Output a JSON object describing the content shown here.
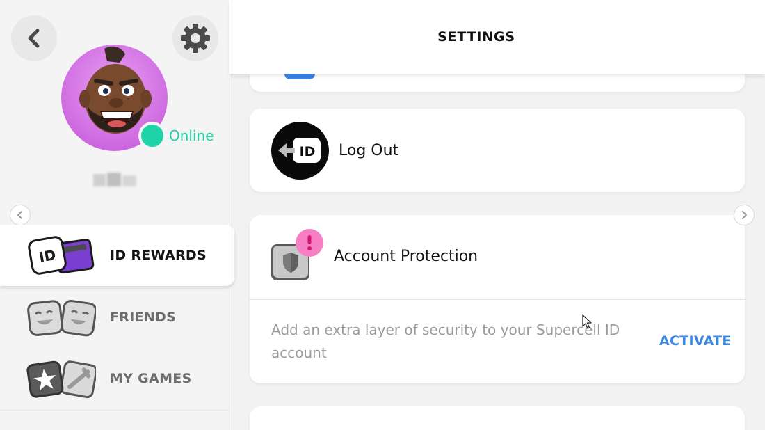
{
  "header": {
    "title": "SETTINGS"
  },
  "profile": {
    "status": "Online"
  },
  "sidebar": {
    "items": [
      {
        "label": "ID REWARDS",
        "active": true,
        "icon": "id-rewards-icon"
      },
      {
        "label": "FRIENDS",
        "active": false,
        "icon": "friends-icon"
      },
      {
        "label": "MY GAMES",
        "active": false,
        "icon": "my-games-icon"
      }
    ]
  },
  "settings": {
    "logout": {
      "label": "Log Out",
      "icon": "logout-id-icon"
    },
    "protection": {
      "label": "Account Protection",
      "description": "Add an extra layer of security to your Supercell ID account",
      "action": "ACTIVATE",
      "icon": "shield-alert-icon"
    }
  },
  "colors": {
    "online": "#1fd3a8",
    "accent_blue": "#3a86e0",
    "alert_pink": "#f77fc4",
    "avatar_bg": "#d66ae6"
  }
}
